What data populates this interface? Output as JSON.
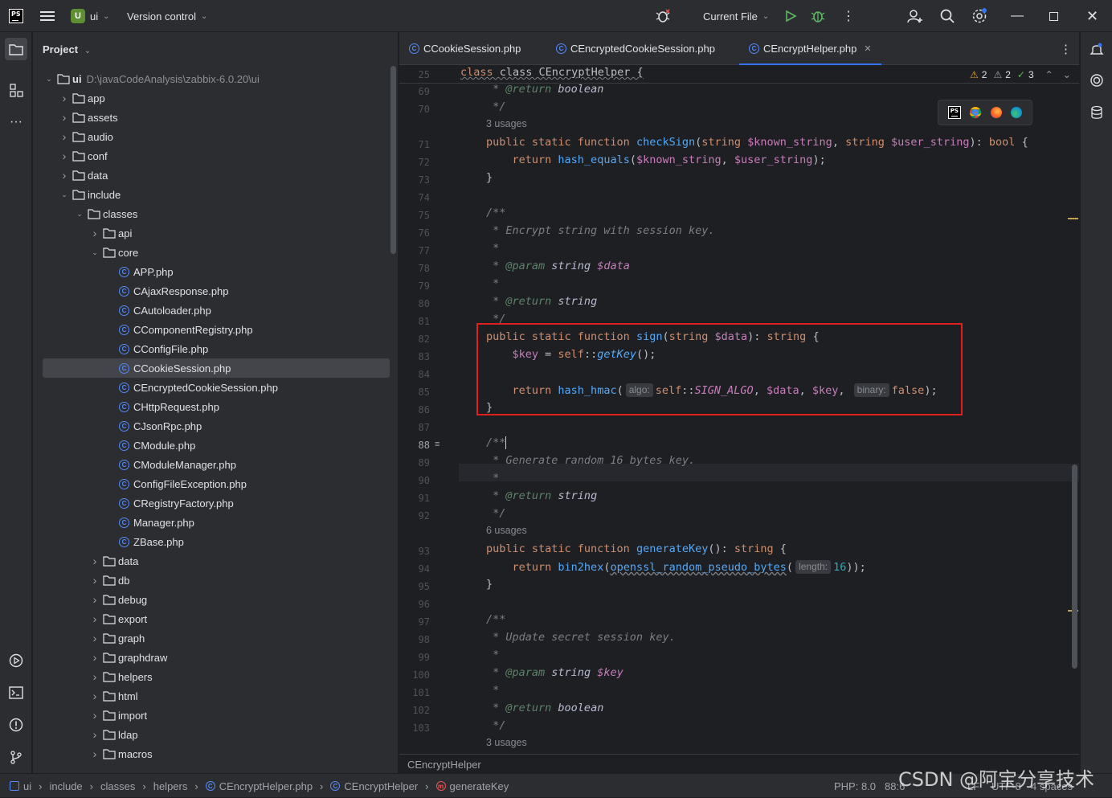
{
  "titlebar": {
    "project_badge": "U",
    "project_name": "ui",
    "vcs_label": "Version control",
    "run_config": "Current File"
  },
  "project_panel": {
    "title": "Project",
    "root_name": "ui",
    "root_path": "D:\\javaCodeAnalysis\\zabbix-6.0.20\\ui",
    "rows": [
      {
        "label": "app",
        "type": "folder",
        "depth": 1,
        "expanded": false
      },
      {
        "label": "assets",
        "type": "folder",
        "depth": 1,
        "expanded": false
      },
      {
        "label": "audio",
        "type": "folder",
        "depth": 1,
        "expanded": false
      },
      {
        "label": "conf",
        "type": "folder",
        "depth": 1,
        "expanded": false
      },
      {
        "label": "data",
        "type": "folder",
        "depth": 1,
        "expanded": false
      },
      {
        "label": "include",
        "type": "folder",
        "depth": 1,
        "expanded": true
      },
      {
        "label": "classes",
        "type": "folder",
        "depth": 2,
        "expanded": true
      },
      {
        "label": "api",
        "type": "folder",
        "depth": 3,
        "expanded": false
      },
      {
        "label": "core",
        "type": "folder",
        "depth": 3,
        "expanded": true
      },
      {
        "label": "APP.php",
        "type": "file",
        "depth": 4
      },
      {
        "label": "CAjaxResponse.php",
        "type": "file",
        "depth": 4
      },
      {
        "label": "CAutoloader.php",
        "type": "file",
        "depth": 4
      },
      {
        "label": "CComponentRegistry.php",
        "type": "file",
        "depth": 4
      },
      {
        "label": "CConfigFile.php",
        "type": "file",
        "depth": 4
      },
      {
        "label": "CCookieSession.php",
        "type": "file",
        "depth": 4,
        "selected": true
      },
      {
        "label": "CEncryptedCookieSession.php",
        "type": "file",
        "depth": 4
      },
      {
        "label": "CHttpRequest.php",
        "type": "file",
        "depth": 4
      },
      {
        "label": "CJsonRpc.php",
        "type": "file",
        "depth": 4
      },
      {
        "label": "CModule.php",
        "type": "file",
        "depth": 4
      },
      {
        "label": "CModuleManager.php",
        "type": "file",
        "depth": 4
      },
      {
        "label": "ConfigFileException.php",
        "type": "file",
        "depth": 4
      },
      {
        "label": "CRegistryFactory.php",
        "type": "file",
        "depth": 4
      },
      {
        "label": "Manager.php",
        "type": "file",
        "depth": 4
      },
      {
        "label": "ZBase.php",
        "type": "file",
        "depth": 4
      },
      {
        "label": "data",
        "type": "folder",
        "depth": 3,
        "expanded": false
      },
      {
        "label": "db",
        "type": "folder",
        "depth": 3,
        "expanded": false
      },
      {
        "label": "debug",
        "type": "folder",
        "depth": 3,
        "expanded": false
      },
      {
        "label": "export",
        "type": "folder",
        "depth": 3,
        "expanded": false
      },
      {
        "label": "graph",
        "type": "folder",
        "depth": 3,
        "expanded": false
      },
      {
        "label": "graphdraw",
        "type": "folder",
        "depth": 3,
        "expanded": false
      },
      {
        "label": "helpers",
        "type": "folder",
        "depth": 3,
        "expanded": false
      },
      {
        "label": "html",
        "type": "folder",
        "depth": 3,
        "expanded": false
      },
      {
        "label": "import",
        "type": "folder",
        "depth": 3,
        "expanded": false
      },
      {
        "label": "ldap",
        "type": "folder",
        "depth": 3,
        "expanded": false
      },
      {
        "label": "macros",
        "type": "folder",
        "depth": 3,
        "expanded": false
      }
    ]
  },
  "tabs": [
    {
      "label": "CCookieSession.php",
      "active": false
    },
    {
      "label": "CEncryptedCookieSession.php",
      "active": false
    },
    {
      "label": "CEncryptHelper.php",
      "active": true
    }
  ],
  "inspections": {
    "warnings": "2",
    "weak_warnings": "2",
    "ok": "3"
  },
  "sticky": {
    "line": "25",
    "text": "class CEncryptHelper {"
  },
  "code": {
    "usages_a": "3 usages",
    "usages_b": "6 usages",
    "usages_c": "3 usages",
    "hint_algo": "algo:",
    "hint_binary": "binary:",
    "hint_length": "length:"
  },
  "line_numbers": [
    "69",
    "70",
    "71",
    "72",
    "73",
    "74",
    "75",
    "76",
    "77",
    "78",
    "79",
    "80",
    "81",
    "82",
    "83",
    "84",
    "85",
    "86",
    "87",
    "88",
    "89",
    "90",
    "91",
    "92",
    "93",
    "94",
    "95",
    "96",
    "97",
    "98",
    "99",
    "100",
    "101",
    "102",
    "103"
  ],
  "editor_breadcrumb": "CEncryptHelper",
  "statusbar": {
    "crumbs": [
      "ui",
      "include",
      "classes",
      "helpers",
      "CEncryptHelper.php",
      "CEncryptHelper",
      "generateKey"
    ],
    "php_version": "PHP: 8.0",
    "position": "88:6",
    "line_sep": "LF",
    "encoding": "UTF-8",
    "indent": "4 spaces"
  },
  "watermark": "CSDN @阿宝分享技术",
  "colors": {
    "accent": "#3574f0",
    "highlight_box": "#e0201f",
    "keyword": "#cf8e6d",
    "function": "#56a8f5",
    "variable": "#c77dbb"
  }
}
